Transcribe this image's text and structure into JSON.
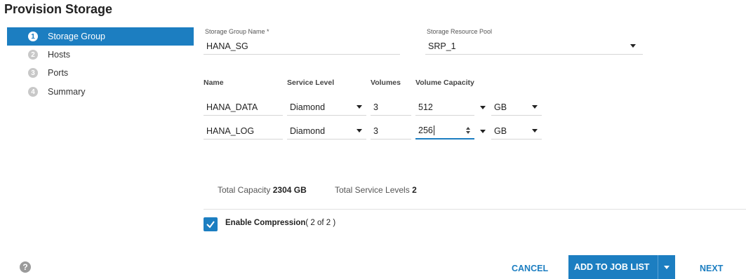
{
  "page": {
    "title": "Provision Storage"
  },
  "steps": [
    {
      "num": "1",
      "label": "Storage Group"
    },
    {
      "num": "2",
      "label": "Hosts"
    },
    {
      "num": "3",
      "label": "Ports"
    },
    {
      "num": "4",
      "label": "Summary"
    }
  ],
  "form": {
    "sg_name_label": "Storage Group Name *",
    "sg_name_value": "HANA_SG",
    "pool_label": "Storage Resource Pool",
    "pool_value": "SRP_1"
  },
  "table": {
    "headers": {
      "name": "Name",
      "service_level": "Service Level",
      "volumes": "Volumes",
      "capacity": "Volume Capacity"
    },
    "rows": [
      {
        "name": "HANA_DATA",
        "service_level": "Diamond",
        "volumes": "3",
        "capacity": "512",
        "unit": "GB"
      },
      {
        "name": "HANA_LOG",
        "service_level": "Diamond",
        "volumes": "3",
        "capacity": "256",
        "unit": "GB"
      }
    ]
  },
  "summary": {
    "total_capacity_label": "Total Capacity",
    "total_capacity_value": "2304 GB",
    "total_service_label": "Total Service Levels",
    "total_service_value": "2"
  },
  "compression": {
    "label": "Enable Compression",
    "suffix": "( 2 of 2 )",
    "checked": true
  },
  "footer": {
    "cancel": "CANCEL",
    "add_to_job_list": "ADD TO JOB LIST",
    "next": "NEXT",
    "help": "?"
  },
  "colors": {
    "accent": "#1c7ec1"
  }
}
